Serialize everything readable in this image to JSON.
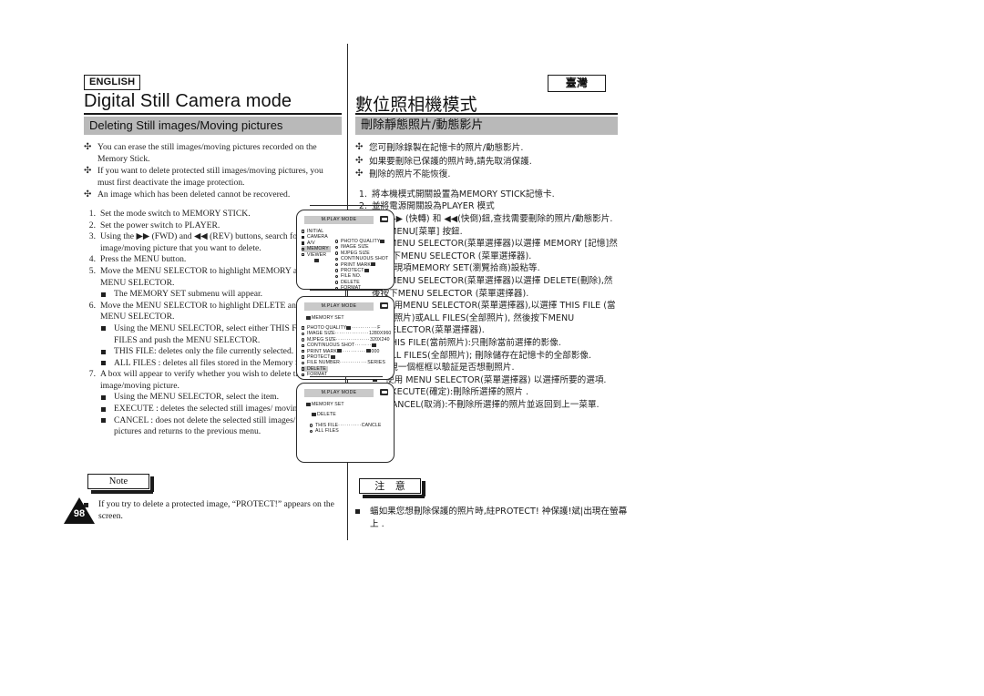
{
  "page": {
    "number": "98",
    "language_badge": "ENGLISH",
    "region_badge": "臺灣"
  },
  "header": {
    "title_en": "Digital Still Camera mode",
    "title_zh": "數位照相機模式",
    "section_en": "Deleting Still images/Moving pictures",
    "section_zh": "刪除靜態照片/動態影片"
  },
  "english": {
    "club_bullets": [
      "You can erase the still images/moving pictures recorded on the Memory Stick.",
      "If you want to delete protected still images/moving pictures, you must first deactivate the image protection.",
      "An image which has been deleted cannot be recovered."
    ],
    "steps": [
      {
        "num": "1.",
        "text": "Set the mode switch to MEMORY STICK.",
        "subs": []
      },
      {
        "num": "2.",
        "text": "Set the power switch to PLAYER.",
        "subs": []
      },
      {
        "num": "3.",
        "text": "Using the ▶▶ (FWD) and ◀◀ (REV) buttons, search for the still image/moving picture that you want to delete.",
        "subs": []
      },
      {
        "num": "4.",
        "text": "Press the MENU button.",
        "subs": []
      },
      {
        "num": "5.",
        "text": "Move the MENU SELECTOR to highlight MEMORY and push the MENU SELECTOR.",
        "subs": [
          "The MEMORY SET submenu will appear."
        ]
      },
      {
        "num": "6.",
        "text": "Move the MENU SELECTOR to highlight DELETE and push the MENU SELECTOR.",
        "subs": [
          "Using the MENU SELECTOR, select either THIS FILE or ALL FILES and push the MENU SELECTOR.",
          "THIS FILE: deletes only the file currently selected.",
          "ALL FILES : deletes all files stored in the Memory Stick."
        ]
      },
      {
        "num": "7.",
        "text": "A box will appear to verify whether you wish to delete the still image/moving picture.",
        "subs": [
          "Using the MENU SELECTOR, select the item.",
          "EXECUTE : deletes the selected still images/ moving pictures.",
          "CANCEL : does not delete the selected still images/moving pictures and returns to the previous menu."
        ]
      }
    ],
    "note_label": "Note",
    "note_text": "If you try to delete a protected image, “PROTECT!” appears on the screen."
  },
  "chinese": {
    "club_bullets": [
      "您可刪除錄製在記憶卡的照片/動態影片.",
      "如果要刪除已保護的照片時,請先取消保護.",
      "刪除的照片不能恢復."
    ],
    "steps": [
      {
        "num": "1.",
        "text": "將本機模式開關設置為MEMORY STICK記憶卡.",
        "subs": []
      },
      {
        "num": "2.",
        "text": "並將電源開關設為PLAYER 模式",
        "subs": []
      },
      {
        "num": "3.",
        "text": "使用▶▶ (快轉) 和 ◀◀(快倒)鈕,查找需要刪除的照片/動態影片.",
        "subs": []
      },
      {
        "num": "4.",
        "text": "按下MENU[菜單] 按鈕.",
        "subs": []
      },
      {
        "num": "5.",
        "text": "轉動MENU SELECTOR(菜單選擇器)以選擇 MEMORY [記憶]然後,按下MENU SELECTOR (菜單選擇器).",
        "subs": [
          "顯現項MEMORY SET(瀏覽拾商)設粘等."
        ]
      },
      {
        "num": "6.",
        "text": "轉動MENU SELECTOR(菜單選擇器)以選擇 DELETE(刪除),然後按下MENU SELECTOR (菜單選擇器).",
        "subs": [
          "使用MENU SELECTOR(菜單選擇器),以選擇 THIS FILE (當前照片)或ALL FILES(全部照片), 然後按下MENU SELECTOR(菜單選擇器).",
          "THIS FILE(當前照片):只刪除當前選擇的影像.",
          "ALL FILES(全部照片); 刪除儲存在記憶卡的全部影像."
        ]
      },
      {
        "num": "7.",
        "text": "會出現一個框框以驗証是否想刪照片.",
        "subs": [
          "使用 MENU SELECTOR(菜單選擇器) 以選擇所要的選項.",
          "EXECUTE(確定):刪除所選擇的照片 .",
          "CANCEL(取消):不刪除所選擇的照片並返回到上一菜單."
        ]
      }
    ],
    "note_label": "注 意",
    "note_text": "蝠如果您想刪除保護的照片時,紸PROTECT! 衶保護!斌|出現在螢幕上 ."
  },
  "lcd_screens": [
    {
      "id": "lcd-main-menu",
      "title": "M.PLAY MODE",
      "left_column": [
        {
          "label": "INITIAL",
          "marker": "square",
          "selected": false
        },
        {
          "label": "CAMERA",
          "marker": "filled",
          "selected": false
        },
        {
          "label": "A/V",
          "marker": "filled",
          "selected": false
        },
        {
          "label": "MEMORY",
          "marker": "square",
          "selected": true
        },
        {
          "label": "VIEWER",
          "marker": "square",
          "selected": false
        }
      ],
      "right_column": [
        {
          "label": "PHOTO QUALITY",
          "marker": "round",
          "icon": "card-icon"
        },
        {
          "label": "IMAGE SIZE",
          "marker": "round"
        },
        {
          "label": "MJPEG SIZE",
          "marker": "round"
        },
        {
          "label": "CONTINUOUS SHOT",
          "marker": "round"
        },
        {
          "label": "PRINT MARK",
          "marker": "round",
          "icon": "print-icon"
        },
        {
          "label": "PROTECT",
          "marker": "round",
          "icon": "key-icon"
        },
        {
          "label": "FILE NO.",
          "marker": "round"
        },
        {
          "label": "DELETE",
          "marker": "round"
        },
        {
          "label": "FORMAT",
          "marker": "round"
        }
      ]
    },
    {
      "id": "lcd-memory-set",
      "title": "M.PLAY MODE",
      "breadcrumb": "MEMORY SET",
      "rows": [
        {
          "label": "PHOTO QUALITY",
          "marker": "square",
          "icon": "card-icon",
          "dots": "············",
          "value": "F",
          "selected": false
        },
        {
          "label": "IMAGE SIZE",
          "marker": "round",
          "dots": "················",
          "value": "1280X960",
          "selected": false
        },
        {
          "label": "MJPEG SIZE",
          "marker": "round",
          "dots": "················",
          "value": "320X240",
          "selected": false
        },
        {
          "label": "CONTINUOUS SHOT",
          "marker": "square",
          "dots": "········",
          "value": "",
          "icon_value": "card-icon",
          "selected": false
        },
        {
          "label": "PRINT MARK",
          "marker": "square",
          "icon": "print-icon",
          "dots": "···········",
          "value": "000",
          "value_icon": "print-icon",
          "selected": false
        },
        {
          "label": "PROTECT",
          "marker": "square",
          "icon": "key-icon",
          "dots": "",
          "value": "",
          "selected": false
        },
        {
          "label": "FILE NUMBER",
          "marker": "round",
          "dots": "·············",
          "value": "SERIES",
          "selected": false
        },
        {
          "label": "DELETE",
          "marker": "square",
          "dots": "",
          "value": "",
          "selected": true
        },
        {
          "label": "FORMAT",
          "marker": "square",
          "dots": "",
          "value": "",
          "selected": false
        }
      ]
    },
    {
      "id": "lcd-delete-confirm",
      "title": "M.PLAY MODE",
      "breadcrumb": "MEMORY SET",
      "submenu": "DELETE",
      "rows": [
        {
          "label": "THIS FILE",
          "marker": "round",
          "dots": "···········",
          "value": "CANCLE"
        },
        {
          "label": "ALL FILES",
          "marker": "round",
          "dots": "",
          "value": ""
        }
      ]
    }
  ]
}
